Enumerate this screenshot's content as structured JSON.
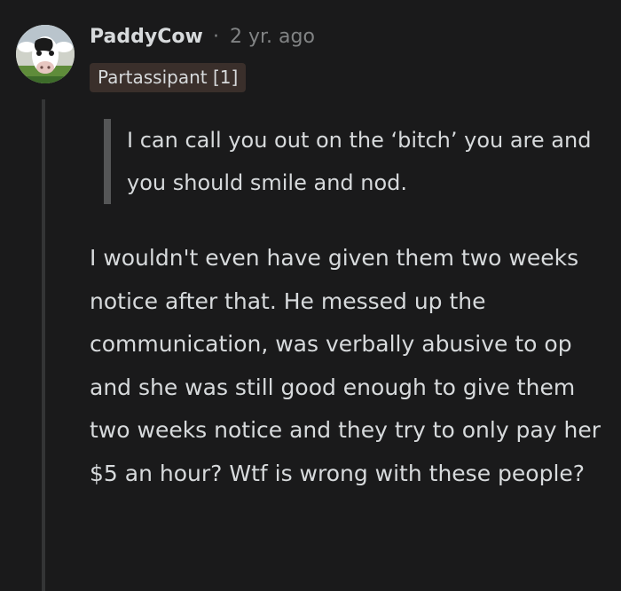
{
  "comment": {
    "author": {
      "username": "PaddyCow",
      "avatar_icon": "cow-avatar-icon",
      "flair": "Partassipant [1]"
    },
    "separator": "·",
    "timestamp": "2 yr. ago",
    "quote": "I can call you out on the ‘bitch’ you are and you should smile and nod.",
    "body": "I wouldn't even have given them two weeks notice after that. He messed up the communication, was verbally abusive to op and she was still good enough to give them two weeks notice and they try to only pay her $5 an hour? Wtf is wrong with these people?"
  },
  "colors": {
    "background": "#1a1a1b",
    "text": "#d7dadc",
    "meta_text": "#818384",
    "flair_background": "#3a2f2b",
    "quote_bar": "#555657",
    "thread_line": "#343536"
  }
}
